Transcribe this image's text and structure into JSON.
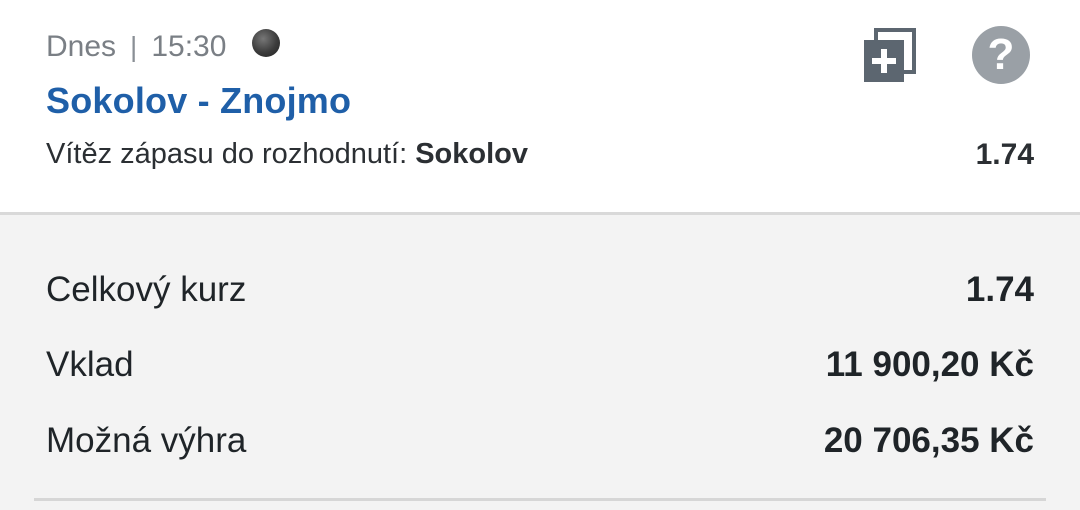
{
  "bet": {
    "day": "Dnes",
    "separator": "|",
    "time": "15:30",
    "match": "Sokolov - Znojmo",
    "market": "Vítěz zápasu do rozhodnutí:",
    "selection": "Sokolov",
    "odds": "1.74",
    "icons": {
      "add": "add-to-betslip-icon",
      "help": "help-icon",
      "status": "live-status-dot-icon"
    },
    "help_glyph": "?"
  },
  "summary": {
    "total_odds_label": "Celkový kurz",
    "total_odds_value": "1.74",
    "stake_label": "Vklad",
    "stake_value": "11 900,20 Kč",
    "win_label": "Možná výhra",
    "win_value": "20 706,35 Kč"
  },
  "colors": {
    "brand_blue": "#1f5fa8",
    "icon_gray": "#5c6670",
    "summary_bg": "#f3f3f3"
  }
}
